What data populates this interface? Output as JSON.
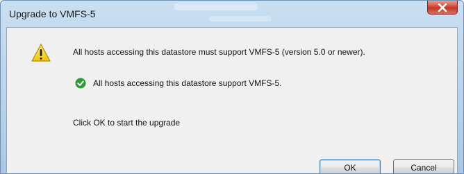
{
  "window": {
    "title": "Upgrade to VMFS-5"
  },
  "icons": {
    "warning": "warning-icon",
    "success": "check-circle-icon",
    "close": "close-icon"
  },
  "messages": {
    "requirement": "All hosts accessing this datastore must support VMFS-5 (version 5.0 or newer).",
    "check_result": "All hosts accessing this datastore support VMFS-5.",
    "instruction": "Click OK to start the upgrade"
  },
  "buttons": {
    "ok": "OK",
    "cancel": "Cancel"
  },
  "colors": {
    "warning_yellow": "#f5d11e",
    "success_green": "#2e9a3a",
    "close_red": "#c0392b"
  }
}
